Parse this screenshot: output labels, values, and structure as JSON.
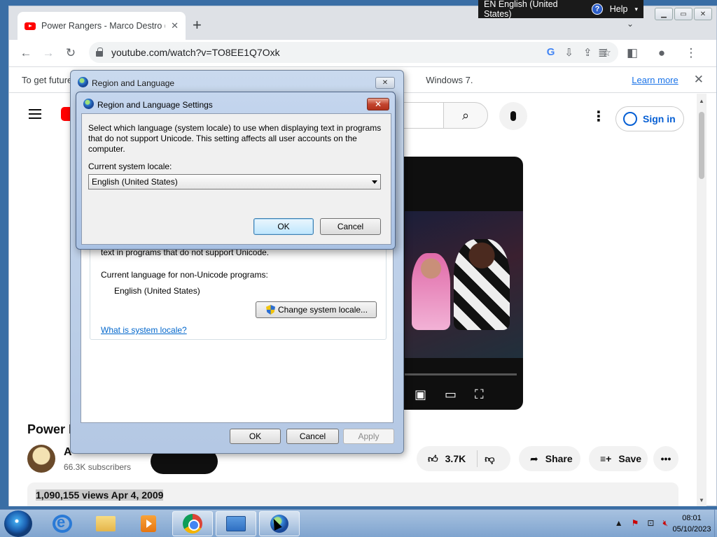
{
  "browser": {
    "tab_title": "Power Rangers - Marco Destro (s",
    "new_tab": "+",
    "url": "youtube.com/watch?v=TO8EE1Q7Oxk",
    "infobar_text": "To get future",
    "infobar_text_end": "Windows 7.",
    "learn_more": "Learn more"
  },
  "langbar": {
    "language": "EN English (United States)",
    "help": "Help"
  },
  "youtube": {
    "signin": "Sign in",
    "title": "Power R",
    "channel_initial": "A",
    "subscribers": "66.3K subscribers",
    "likes": "3.7K",
    "share": "Share",
    "save": "Save",
    "views_date": "1,090,155 views  Apr 4, 2009"
  },
  "region_dialog": {
    "title": "Region and Language",
    "unicode_text": "text in programs that do not support Unicode.",
    "current_language_label": "Current language for non-Unicode programs:",
    "current_language_value": "English (United States)",
    "change_locale_button": "Change system locale...",
    "what_is_link": "What is system locale?",
    "ok": "OK",
    "cancel": "Cancel",
    "apply": "Apply"
  },
  "settings_dialog": {
    "title": "Region and Language Settings",
    "description": "Select which language (system locale) to use when displaying text in programs that do not support Unicode. This setting affects all user accounts on the computer.",
    "locale_label": "Current system locale:",
    "locale_value": "English (United States)",
    "ok": "OK",
    "cancel": "Cancel"
  },
  "taskbar": {
    "time": "08:01",
    "date": "05/10/2023"
  }
}
